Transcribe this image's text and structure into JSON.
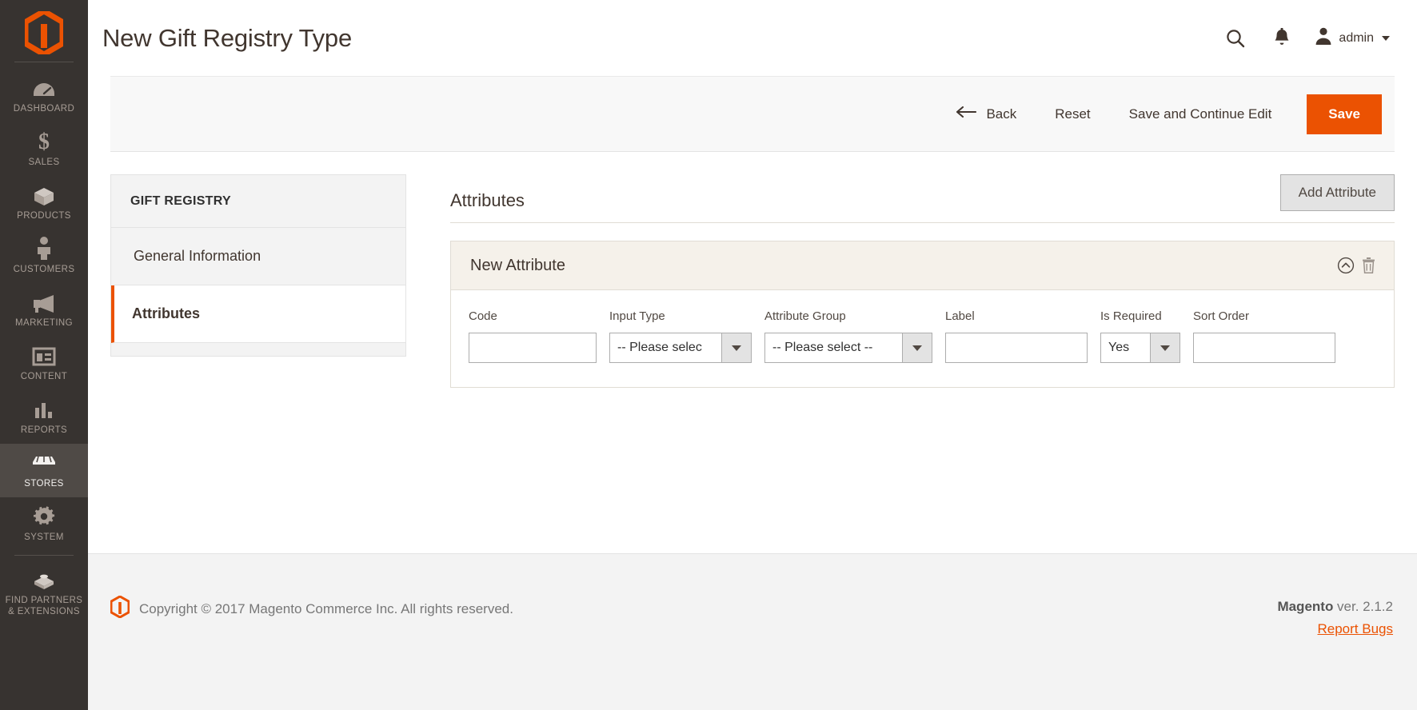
{
  "brand": {
    "logo_icon": "magento-logo-icon",
    "accent": "#eb5202",
    "nav_bg": "#373330"
  },
  "admin_nav": {
    "items": [
      {
        "label": "DASHBOARD",
        "icon": "dashboard-icon",
        "active": false
      },
      {
        "label": "SALES",
        "icon": "dollar-icon",
        "active": false
      },
      {
        "label": "PRODUCTS",
        "icon": "box-icon",
        "active": false
      },
      {
        "label": "CUSTOMERS",
        "icon": "person-icon",
        "active": false
      },
      {
        "label": "MARKETING",
        "icon": "megaphone-icon",
        "active": false
      },
      {
        "label": "CONTENT",
        "icon": "layout-icon",
        "active": false
      },
      {
        "label": "REPORTS",
        "icon": "bar-chart-icon",
        "active": false
      },
      {
        "label": "STORES",
        "icon": "storefront-icon",
        "active": true
      },
      {
        "label": "SYSTEM",
        "icon": "gear-icon",
        "active": false
      },
      {
        "label": "FIND PARTNERS\n& EXTENSIONS",
        "label_line1": "FIND PARTNERS",
        "label_line2": "& EXTENSIONS",
        "icon": "extension-icon",
        "active": false
      }
    ]
  },
  "header": {
    "title": "New Gift Registry Type",
    "search_icon": "search-icon",
    "notifications_icon": "bell-icon",
    "user_icon": "user-avatar-icon",
    "user_name": "admin"
  },
  "page_actions": {
    "back_label": "Back",
    "back_icon": "arrow-left-icon",
    "reset_label": "Reset",
    "save_continue_label": "Save and Continue Edit",
    "save_label": "Save"
  },
  "side_panel": {
    "title": "GIFT REGISTRY",
    "items": [
      {
        "label": "General Information",
        "current": false
      },
      {
        "label": "Attributes",
        "current": true
      }
    ]
  },
  "attributes_section": {
    "heading": "Attributes",
    "add_button_label": "Add Attribute",
    "card": {
      "title": "New Attribute",
      "collapse_icon": "chevron-up-circle-icon",
      "delete_icon": "trash-icon",
      "fields": [
        {
          "key": "code",
          "label": "Code",
          "type": "text",
          "value": "",
          "size": "f-code"
        },
        {
          "key": "input_type",
          "label": "Input Type",
          "type": "select",
          "value": "-- Please selec",
          "size": "f-input"
        },
        {
          "key": "attr_group",
          "label": "Attribute Group",
          "type": "select",
          "value": "-- Please select --",
          "size": "f-group"
        },
        {
          "key": "label",
          "label": "Label",
          "type": "text",
          "value": "",
          "size": "f-label"
        },
        {
          "key": "is_required",
          "label": "Is Required",
          "type": "select",
          "value": "Yes",
          "size": "f-req"
        },
        {
          "key": "sort_order",
          "label": "Sort Order",
          "type": "text",
          "value": "",
          "size": "f-sort"
        }
      ]
    }
  },
  "footer": {
    "logo_icon": "magento-logo-icon",
    "copyright": "Copyright © 2017 Magento Commerce Inc. All rights reserved.",
    "brand_name": "Magento",
    "version_text": " ver. 2.1.2",
    "report_bugs_label": "Report Bugs"
  }
}
